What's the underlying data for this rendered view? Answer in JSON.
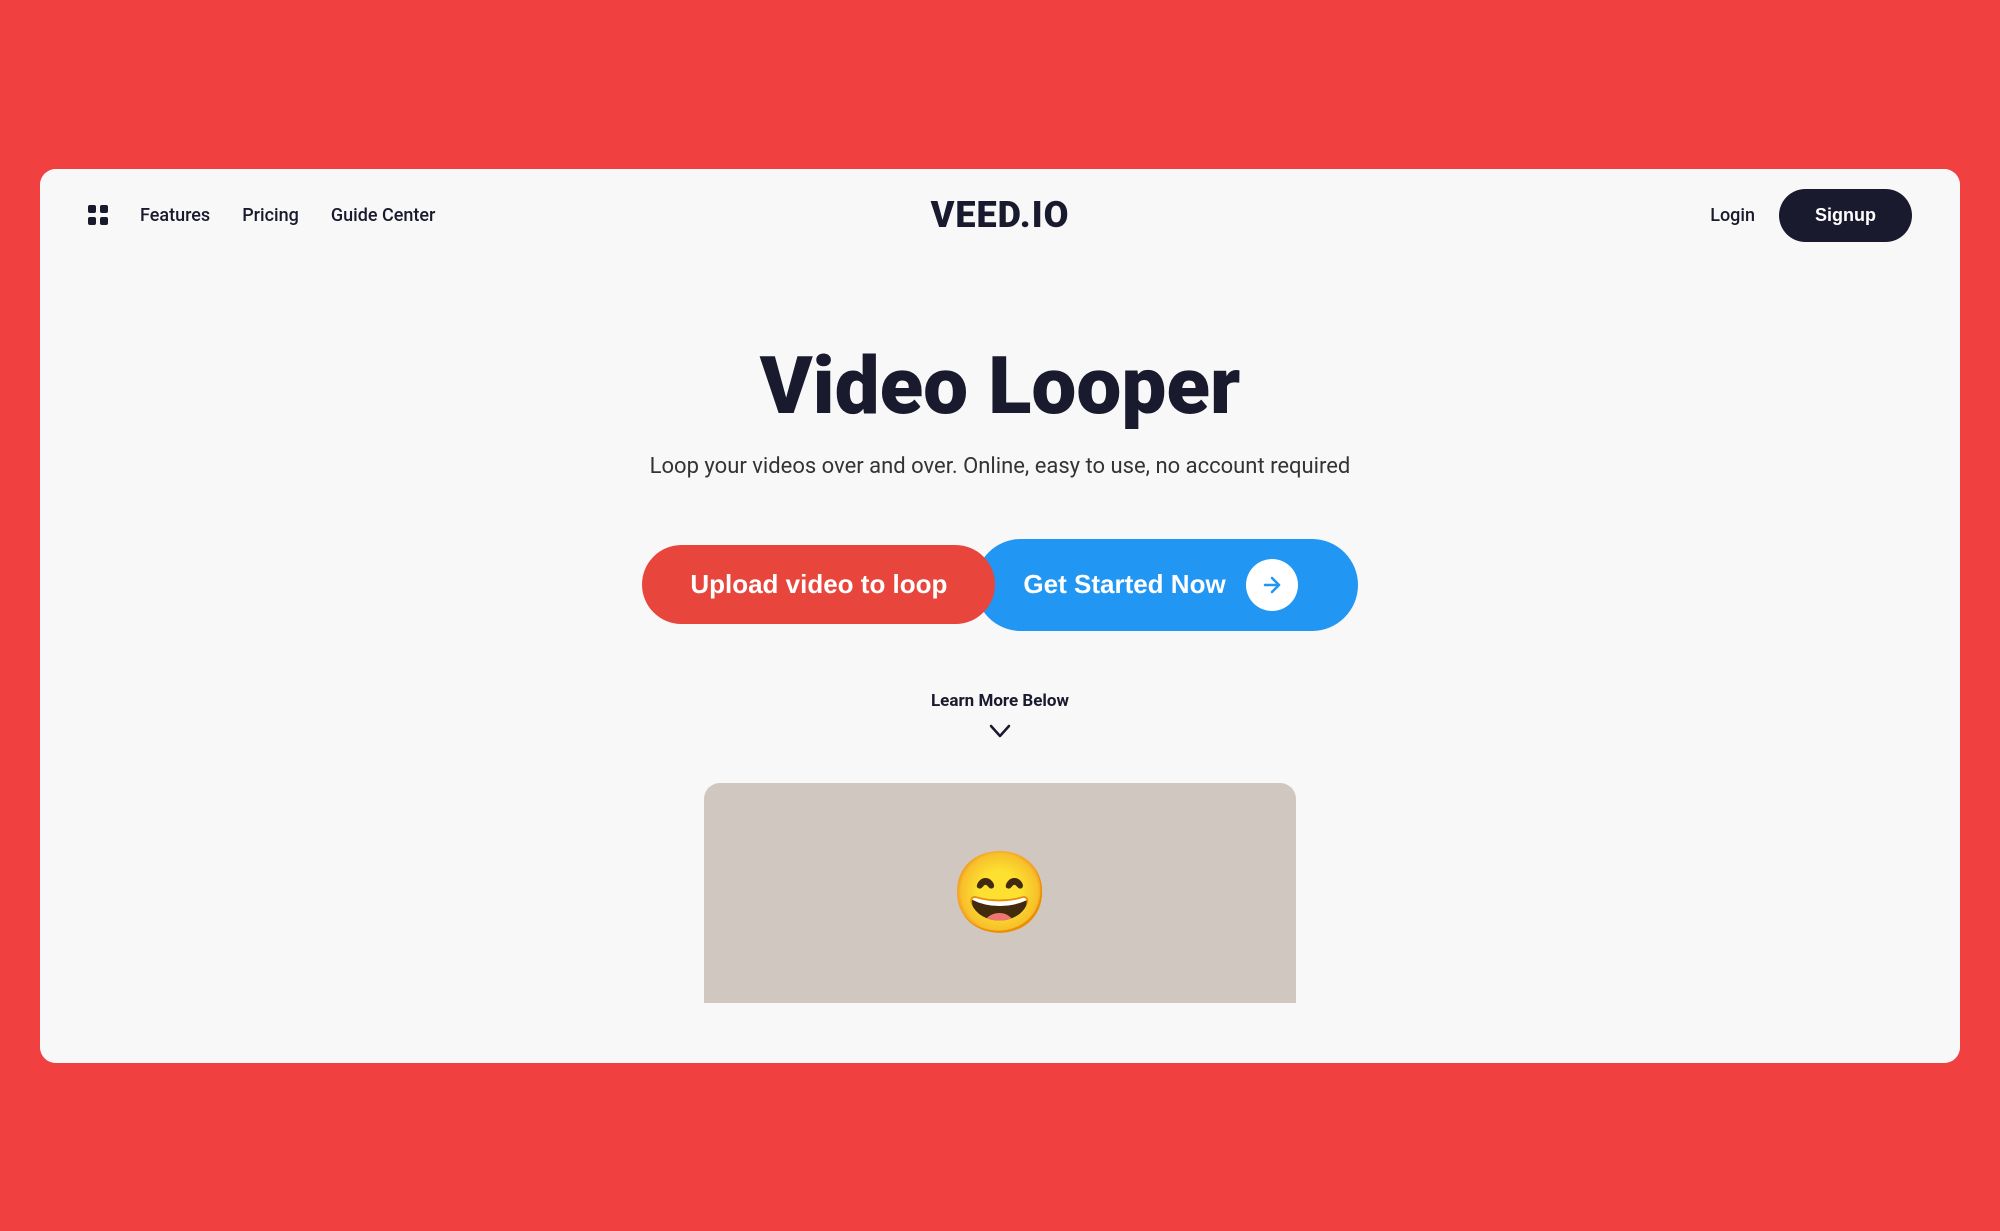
{
  "page": {
    "background_color": "#f04040",
    "container_color": "#f8f8f8"
  },
  "navbar": {
    "features_label": "Features",
    "pricing_label": "Pricing",
    "guide_center_label": "Guide Center",
    "logo_text": "VEED.IO",
    "login_label": "Login",
    "signup_label": "Signup"
  },
  "hero": {
    "title": "Video Looper",
    "subtitle": "Loop your videos over and over. Online, easy to use, no account required",
    "upload_btn_label": "Upload video to loop",
    "get_started_label": "Get Started Now",
    "learn_more_label": "Learn More Below",
    "arrow_icon": "→",
    "chevron_icon": "∨"
  },
  "thumbnails": [
    {
      "id": "left",
      "type": "plain"
    },
    {
      "id": "center",
      "type": "emoji",
      "content": "😄"
    },
    {
      "id": "right",
      "type": "plain"
    }
  ]
}
